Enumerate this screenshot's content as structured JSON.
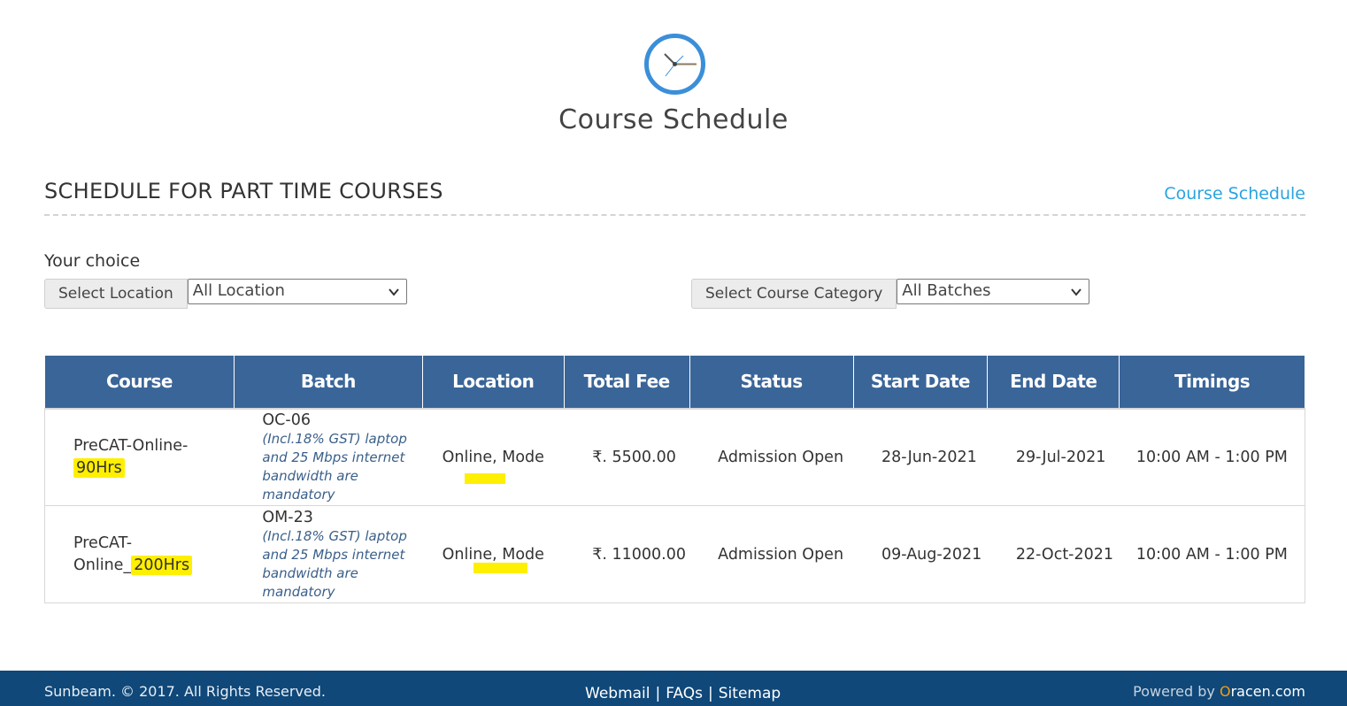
{
  "header": {
    "clock_icon": "clock-icon",
    "title": "Course Schedule"
  },
  "section": {
    "title": "SCHEDULE FOR PART TIME COURSES",
    "link": "Course Schedule"
  },
  "filters": {
    "choice_label": "Your choice",
    "location": {
      "label": "Select Location",
      "value": "All Location"
    },
    "category": {
      "label": "Select Course Category",
      "value": "All Batches"
    }
  },
  "table": {
    "headers": [
      "Course",
      "Batch",
      "Location",
      "Total Fee",
      "Status",
      "Start Date",
      "End Date",
      "Timings"
    ],
    "rows": [
      {
        "course_a": "PreCAT-Online-",
        "course_b": "90Hrs",
        "batch_code": "OC-06",
        "batch_note": "(Incl.18% GST) laptop and 25 Mbps internet bandwidth are mandatory",
        "location": "Online, Mode",
        "fee": "₹. 5500.00",
        "status": "Admission Open",
        "start": "28-Jun-2021",
        "end": "29-Jul-2021",
        "timings": "10:00 AM - 1:00 PM"
      },
      {
        "course_a": "PreCAT-",
        "course_b1": "Online_",
        "course_b2": "200Hrs",
        "batch_code": "OM-23",
        "batch_note": "(Incl.18% GST) laptop and 25 Mbps internet bandwidth are mandatory",
        "location": "Online, Mode",
        "fee": "₹. 11000.00",
        "status": "Admission Open",
        "start": "09-Aug-2021",
        "end": "22-Oct-2021",
        "timings": "10:00 AM - 1:00 PM"
      }
    ]
  },
  "footer": {
    "copyright": "Sunbeam. © 2017. All Rights Reserved.",
    "links": [
      "Webmail",
      "FAQs",
      "Sitemap"
    ],
    "sep": "|",
    "powered_prefix": "Powered by ",
    "brand_o": "O",
    "brand_rest": "racen.com"
  },
  "colors": {
    "table_header": "#3a6598",
    "link": "#2aa3e0",
    "status": "#3a72a8",
    "highlight": "#ffef00",
    "footer_bg": "#0f4879"
  }
}
